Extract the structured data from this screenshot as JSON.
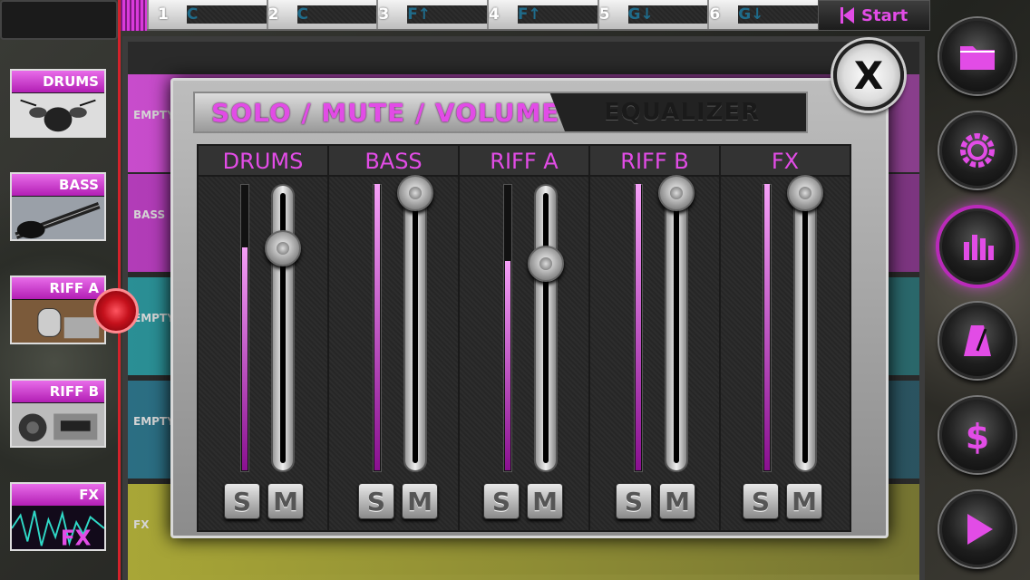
{
  "topbar": {
    "chords": [
      {
        "num": "1",
        "chord": "C"
      },
      {
        "num": "2",
        "chord": "C"
      },
      {
        "num": "3",
        "chord": "F↑"
      },
      {
        "num": "4",
        "chord": "F↑"
      },
      {
        "num": "5",
        "chord": "G↓"
      },
      {
        "num": "6",
        "chord": "G↓"
      }
    ],
    "start_label": "Start"
  },
  "tracks": [
    {
      "label": "DRUMS"
    },
    {
      "label": "BASS"
    },
    {
      "label": "RIFF A"
    },
    {
      "label": "RIFF B"
    },
    {
      "label": "FX"
    }
  ],
  "lanes": [
    {
      "label": "EMPTY",
      "color": "#c84ccc"
    },
    {
      "label": "BASS",
      "color": "#b23cb8"
    },
    {
      "label": "EMPTY",
      "color": "#2a8f95"
    },
    {
      "label": "EMPTY",
      "color": "#2b6e83"
    },
    {
      "label": "FX",
      "color": "#a8a637"
    }
  ],
  "modal": {
    "tab_active": "SOLO / MUTE / VOLUME",
    "tab_inactive": "EQUALIZER",
    "close_label": "X",
    "channels": [
      {
        "name": "DRUMS",
        "volume": 0.78,
        "level": 0.78,
        "solo": "S",
        "mute": "M"
      },
      {
        "name": "BASS",
        "volume": 1.0,
        "level": 1.0,
        "solo": "S",
        "mute": "M"
      },
      {
        "name": "RIFF A",
        "volume": 0.72,
        "level": 0.73,
        "solo": "S",
        "mute": "M"
      },
      {
        "name": "RIFF B",
        "volume": 1.0,
        "level": 1.0,
        "solo": "S",
        "mute": "M"
      },
      {
        "name": "FX",
        "volume": 1.0,
        "level": 1.0,
        "solo": "S",
        "mute": "M"
      }
    ]
  },
  "right_buttons": [
    {
      "name": "folder-icon"
    },
    {
      "name": "gear-icon"
    },
    {
      "name": "mixer-icon",
      "active": true
    },
    {
      "name": "metronome-icon"
    },
    {
      "name": "dollar-icon"
    },
    {
      "name": "play-icon"
    }
  ],
  "accent_color": "#e24ce6"
}
